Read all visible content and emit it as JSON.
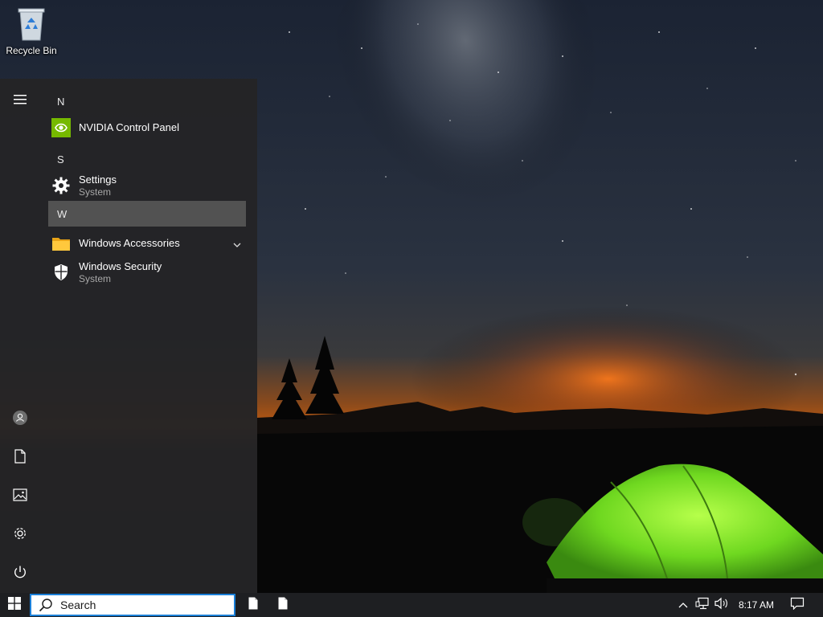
{
  "desktop": {
    "icons": [
      {
        "label": "Recycle Bin",
        "icon": "recycle-bin-icon"
      }
    ]
  },
  "start_menu": {
    "rail": [
      {
        "name": "expand-menu-icon"
      },
      {
        "name": "user-account-icon"
      },
      {
        "name": "documents-icon"
      },
      {
        "name": "pictures-icon"
      },
      {
        "name": "settings-icon"
      },
      {
        "name": "power-icon"
      }
    ],
    "groups": [
      {
        "letter": "N",
        "apps": [
          {
            "name": "NVIDIA Control Panel",
            "sub": "",
            "icon": "nvidia-icon"
          }
        ]
      },
      {
        "letter": "S",
        "apps": [
          {
            "name": "Settings",
            "sub": "System",
            "icon": "gear-icon"
          }
        ]
      },
      {
        "letter": "W",
        "selected": true,
        "apps": [
          {
            "name": "Windows Accessories",
            "sub": "",
            "icon": "folder-icon",
            "expandable": true
          },
          {
            "name": "Windows Security",
            "sub": "System",
            "icon": "shield-icon"
          }
        ]
      }
    ]
  },
  "taskbar": {
    "search_placeholder": "Search",
    "pinned": [
      "file-icon",
      "file-icon"
    ],
    "tray": [
      "show-hidden-icons-chevron",
      "network-icon",
      "volume-icon"
    ],
    "clock": "8:17 AM",
    "notifications_icon": "action-center-icon"
  },
  "colors": {
    "accent": "#1a7fd8",
    "menu_bg": "#242426",
    "selected_bg": "#525252",
    "tent": "#7be32e",
    "nvidia": "#76b900"
  }
}
